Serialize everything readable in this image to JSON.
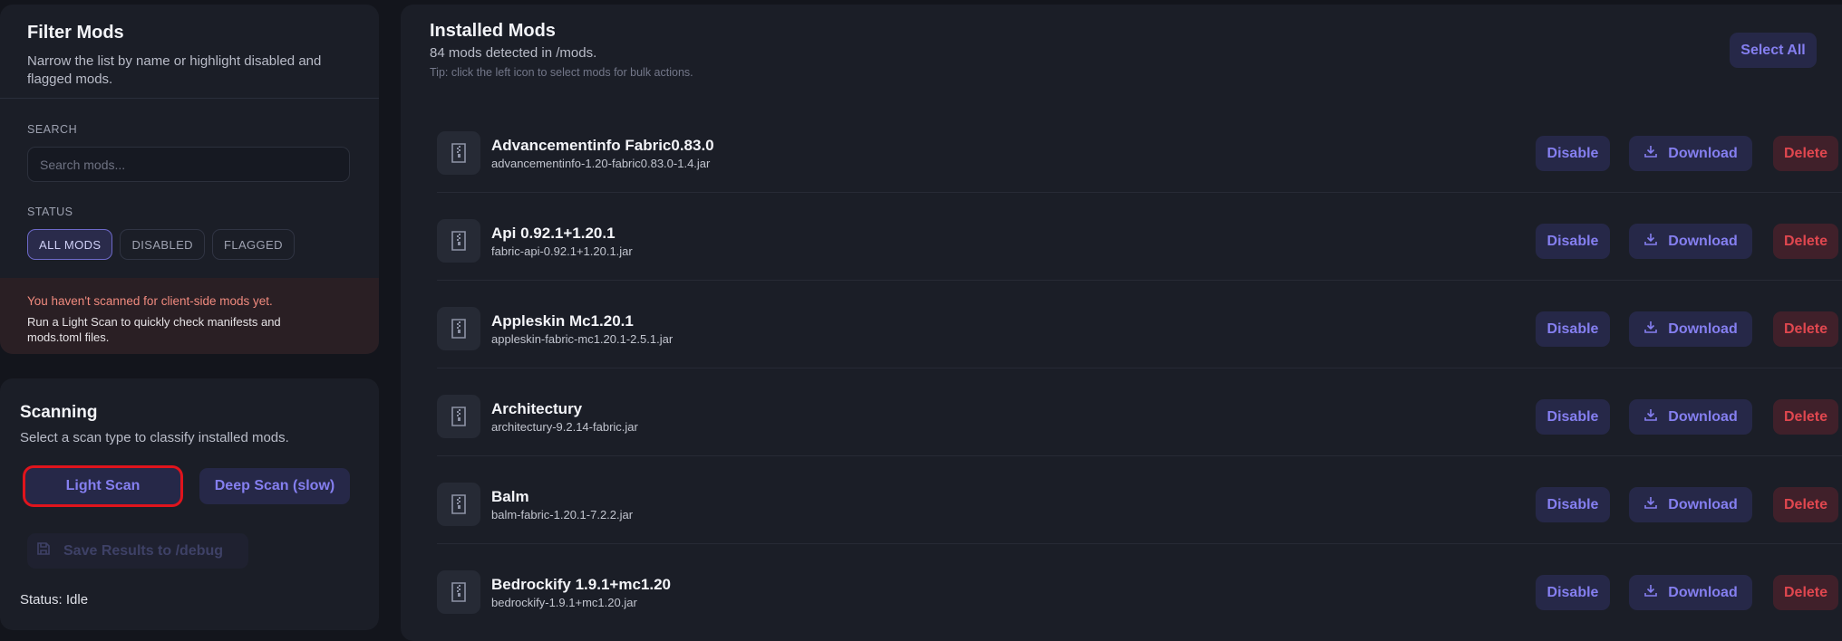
{
  "filter": {
    "title": "Filter Mods",
    "description": "Narrow the list by name or highlight disabled and flagged mods.",
    "search_label": "SEARCH",
    "search_placeholder": "Search mods...",
    "status_label": "STATUS",
    "chips": [
      "ALL MODS",
      "DISABLED",
      "FLAGGED"
    ],
    "active_chip": "ALL MODS",
    "warning_title": "You haven't scanned for client-side mods yet.",
    "warning_text": "Run a Light Scan to quickly check manifests and mods.toml files."
  },
  "scanning": {
    "title": "Scanning",
    "description": "Select a scan type to classify installed mods.",
    "light_scan_label": "Light Scan",
    "deep_scan_label": "Deep Scan (slow)",
    "save_results_label": "Save Results to /debug",
    "status_text": "Status: Idle"
  },
  "main": {
    "title": "Installed Mods",
    "count_text": "84 mods detected in /mods.",
    "tip": "Tip: click the left icon to select mods for bulk actions.",
    "select_all_label": "Select All",
    "disable_label": "Disable",
    "download_label": "Download",
    "delete_label": "Delete",
    "mods": [
      {
        "name": "Advancementinfo Fabric0.83.0",
        "file": "advancementinfo-1.20-fabric0.83.0-1.4.jar"
      },
      {
        "name": "Api 0.92.1+1.20.1",
        "file": "fabric-api-0.92.1+1.20.1.jar"
      },
      {
        "name": "Appleskin Mc1.20.1",
        "file": "appleskin-fabric-mc1.20.1-2.5.1.jar"
      },
      {
        "name": "Architectury",
        "file": "architectury-9.2.14-fabric.jar"
      },
      {
        "name": "Balm",
        "file": "balm-fabric-1.20.1-7.2.2.jar"
      },
      {
        "name": "Bedrockify 1.9.1+mc1.20",
        "file": "bedrockify-1.9.1+mc1.20.jar"
      }
    ]
  },
  "colors": {
    "background": "#13151c",
    "panel": "#1b1e27",
    "accent": "#857ff0",
    "danger": "#e0474f",
    "warning_text": "#f08a7e",
    "highlight_outline": "#e0141c"
  }
}
